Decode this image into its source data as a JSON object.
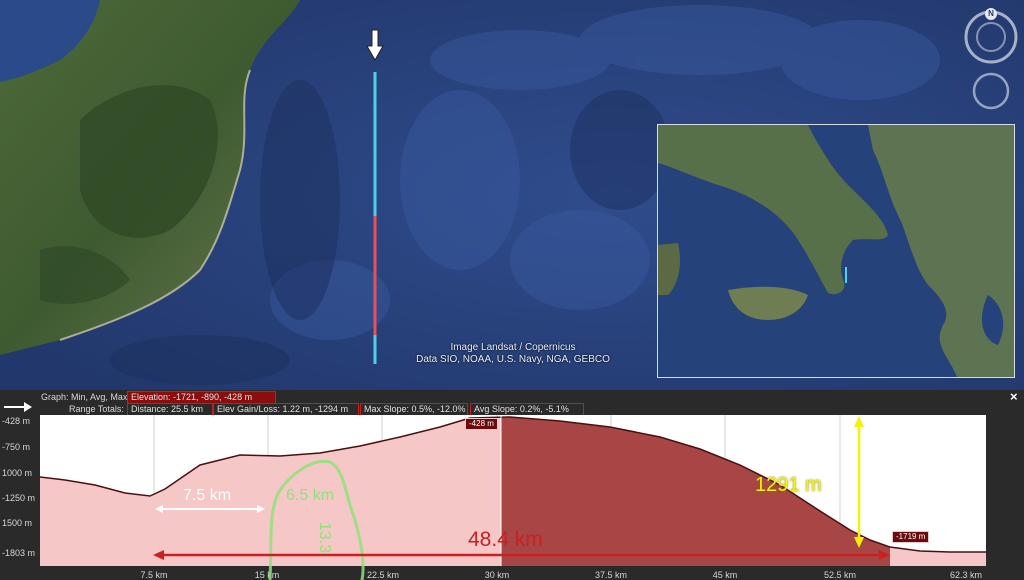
{
  "map": {
    "attribution_line1": "Image Landsat / Copernicus",
    "attribution_line2": "Data SIO, NOAA, U.S. Navy, NGA, GEBCO",
    "compass_label": "N"
  },
  "profile": {
    "graph_label": "Graph: Min, Avg, Max",
    "elevation": "Elevation: -1721, -890, -428 m",
    "range_label": "Range Totals:",
    "distance": "Distance: 25.5 km",
    "elev_gain_loss": "Elev Gain/Loss: 1.22 m, -1294 m",
    "max_slope": "Max Slope: 0.5%, -12.0%",
    "avg_slope": "Avg Slope: 0.2%, -5.1%",
    "close_label": "×",
    "marker_top": "-428 m",
    "marker_bottom": "-1719 m",
    "y_ticks": [
      "-428 m",
      "-750 m",
      "1000 m",
      "-1250 m",
      "1500 m",
      "-1803 m"
    ],
    "x_ticks": [
      "7.5 km",
      "15 km",
      "22.5 km",
      "30 km",
      "37.5 km",
      "45 km",
      "52.5 km",
      "62.3 km"
    ]
  },
  "annotations": {
    "width_label": "7.5 km",
    "green_label": "6.5 km",
    "green_vertical": "13.3",
    "drop_label": "1291 m",
    "length_label": "48.4 km"
  },
  "colors": {
    "path_cyan": "#4fd0e8",
    "path_red": "#e8505a",
    "stat_border": "#c21f1f",
    "profile_fill": "#f6c7c7",
    "profile_selected": "#a84646",
    "arrow_red": "#cc1f1f",
    "yellow": "#f2f20a",
    "green": "#8fe27a"
  }
}
